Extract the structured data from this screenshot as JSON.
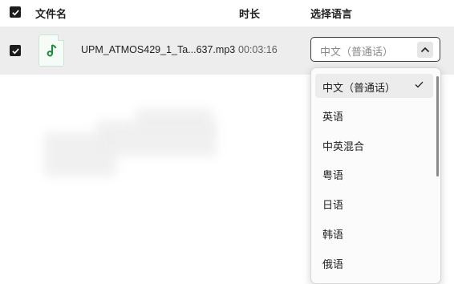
{
  "header": {
    "file_name_label": "文件名",
    "duration_label": "时长",
    "language_label": "选择语言"
  },
  "row": {
    "file_name": "UPM_ATMOS429_1_Ta...637.mp3",
    "duration": "00:03:16",
    "selected_language": "中文（普通话）",
    "icon": "music-note-icon"
  },
  "dropdown": {
    "options": [
      {
        "label": "中文（普通话）",
        "selected": true
      },
      {
        "label": "英语",
        "selected": false
      },
      {
        "label": "中英混合",
        "selected": false
      },
      {
        "label": "粤语",
        "selected": false
      },
      {
        "label": "日语",
        "selected": false
      },
      {
        "label": "韩语",
        "selected": false
      },
      {
        "label": "俄语",
        "selected": false
      }
    ]
  },
  "colors": {
    "accent_green": "#1e8c3a",
    "checkbox": "#1c1c1c",
    "row_bg": "#ededed"
  }
}
